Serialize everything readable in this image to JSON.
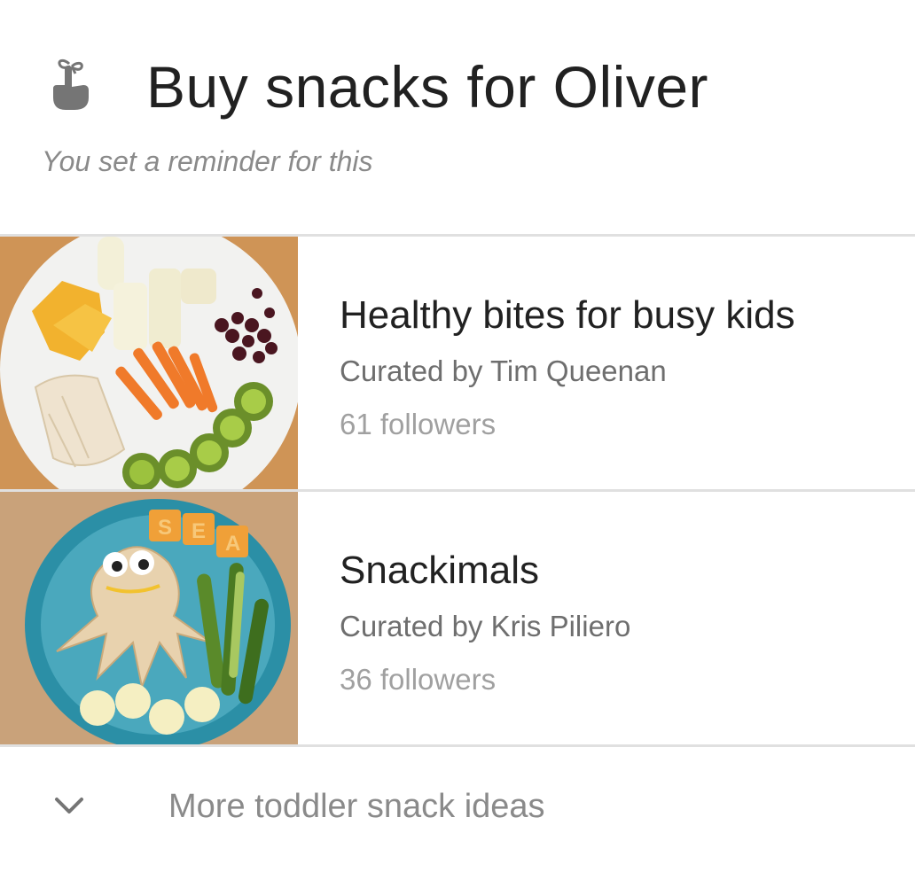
{
  "header": {
    "icon": "finger-string-reminder-icon",
    "title": "Buy snacks for Oliver",
    "subtitle": "You set a reminder for this"
  },
  "collections": [
    {
      "title": "Healthy bites for busy kids",
      "curator": "Curated by Tim Queenan",
      "followers": "61 followers",
      "image": "plate-of-fruit-vegetables-chicken-snacks"
    },
    {
      "title": "Snackimals",
      "curator": "Curated by Kris Piliero",
      "followers": "36 followers",
      "image": "octopus-sandwich-sea-crackers-plate"
    }
  ],
  "more": {
    "icon": "chevron-down-icon",
    "label": "More toddler snack ideas"
  },
  "colors": {
    "title_text": "#212121",
    "secondary_text": "#6e6e6e",
    "tertiary_text": "#a0a0a0",
    "divider": "#e0e0e0",
    "icon": "#757575"
  }
}
